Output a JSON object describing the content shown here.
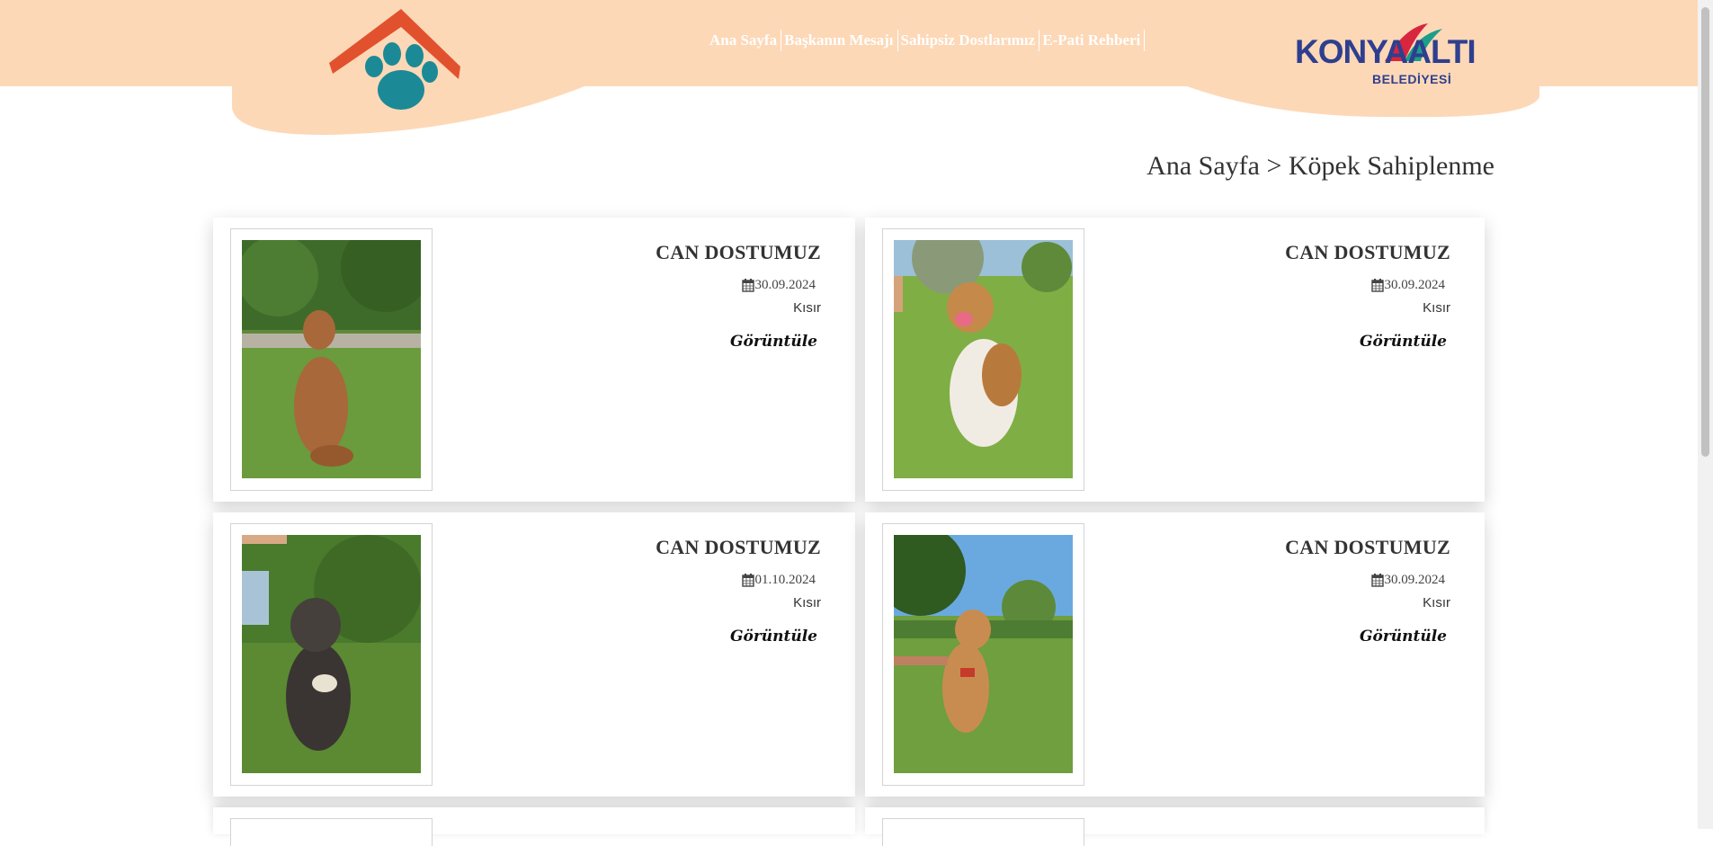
{
  "nav": {
    "items": [
      {
        "label": "Ana Sayfa"
      },
      {
        "label": "Başkanın Mesajı"
      },
      {
        "label": "Sahipsiz Dostlarımız"
      },
      {
        "label": "E-Pati Rehberi"
      }
    ]
  },
  "brand": {
    "name": "KONYAALTI",
    "subtitle": "BELEDİYESİ"
  },
  "breadcrumb": "Ana Sayfa > Köpek Sahiplenme",
  "colors": {
    "header_bg": "#fdd8b7",
    "roof": "#e2512e",
    "paw": "#1b8a96",
    "brand_blue": "#2e3f8f"
  },
  "cards": [
    {
      "title": "CAN DOSTUMUZ",
      "date": "30.09.2024",
      "status": "Kısır",
      "view_label": "Görüntüle"
    },
    {
      "title": "CAN DOSTUMUZ",
      "date": "30.09.2024",
      "status": "Kısır",
      "view_label": "Görüntüle"
    },
    {
      "title": "CAN DOSTUMUZ",
      "date": "01.10.2024",
      "status": "Kısır",
      "view_label": "Görüntüle"
    },
    {
      "title": "CAN DOSTUMUZ",
      "date": "30.09.2024",
      "status": "Kısır",
      "view_label": "Görüntüle"
    }
  ],
  "icons": {
    "date": "calendar-icon"
  }
}
